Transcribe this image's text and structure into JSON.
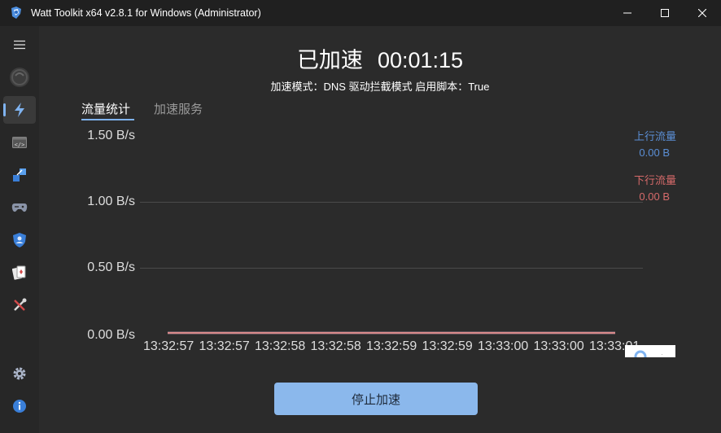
{
  "window": {
    "title": "Watt Toolkit x64 v2.8.1 for Windows (Administrator)",
    "bg": "#202020"
  },
  "sidebar": {
    "items": [
      {
        "name": "menu",
        "icon": "hamburger-icon"
      },
      {
        "name": "avatar",
        "icon": "avatar-icon"
      },
      {
        "name": "accelerate",
        "icon": "lightning-icon",
        "active": true
      },
      {
        "name": "script",
        "icon": "code-window-icon"
      },
      {
        "name": "transfer",
        "icon": "arrows-icon"
      },
      {
        "name": "game",
        "icon": "gamepad-icon"
      },
      {
        "name": "security",
        "icon": "shield-user-icon"
      },
      {
        "name": "cards",
        "icon": "cards-icon"
      },
      {
        "name": "tools",
        "icon": "tools-icon"
      },
      {
        "name": "settings",
        "icon": "gear-icon"
      },
      {
        "name": "about",
        "icon": "info-icon"
      }
    ]
  },
  "status": {
    "state": "已加速",
    "timer": "00:01:15",
    "mode_line": "加速模式：DNS 驱动拦截模式  启用脚本：True"
  },
  "tabs": [
    {
      "label": "流量统计",
      "active": true
    },
    {
      "label": "加速服务",
      "active": false
    }
  ],
  "legend": {
    "upload_label": "上行流量",
    "upload_value": "0.00 B",
    "download_label": "下行流量",
    "download_value": "0.00 B",
    "upload_color": "#5b8fd6",
    "download_color": "#d66a6a"
  },
  "chart_data": {
    "type": "line",
    "x": [
      "13:32:57",
      "13:32:57",
      "13:32:58",
      "13:32:58",
      "13:32:59",
      "13:32:59",
      "13:33:00",
      "13:33:00",
      "13:33:01"
    ],
    "y_ticks": [
      "1.50 B/s",
      "1.00 B/s",
      "0.50 B/s",
      "0.00 B/s"
    ],
    "ylim": [
      0,
      1.5
    ],
    "series": [
      {
        "name": "上行流量",
        "values": [
          0,
          0,
          0,
          0,
          0,
          0,
          0,
          0,
          0
        ],
        "color": "#5b8fd6"
      },
      {
        "name": "下行流量",
        "values": [
          0,
          0,
          0,
          0,
          0,
          0,
          0,
          0,
          0
        ],
        "color": "#d98a8a"
      }
    ],
    "grid": true,
    "legend": "right"
  },
  "button": {
    "stop_label": "停止加速"
  }
}
